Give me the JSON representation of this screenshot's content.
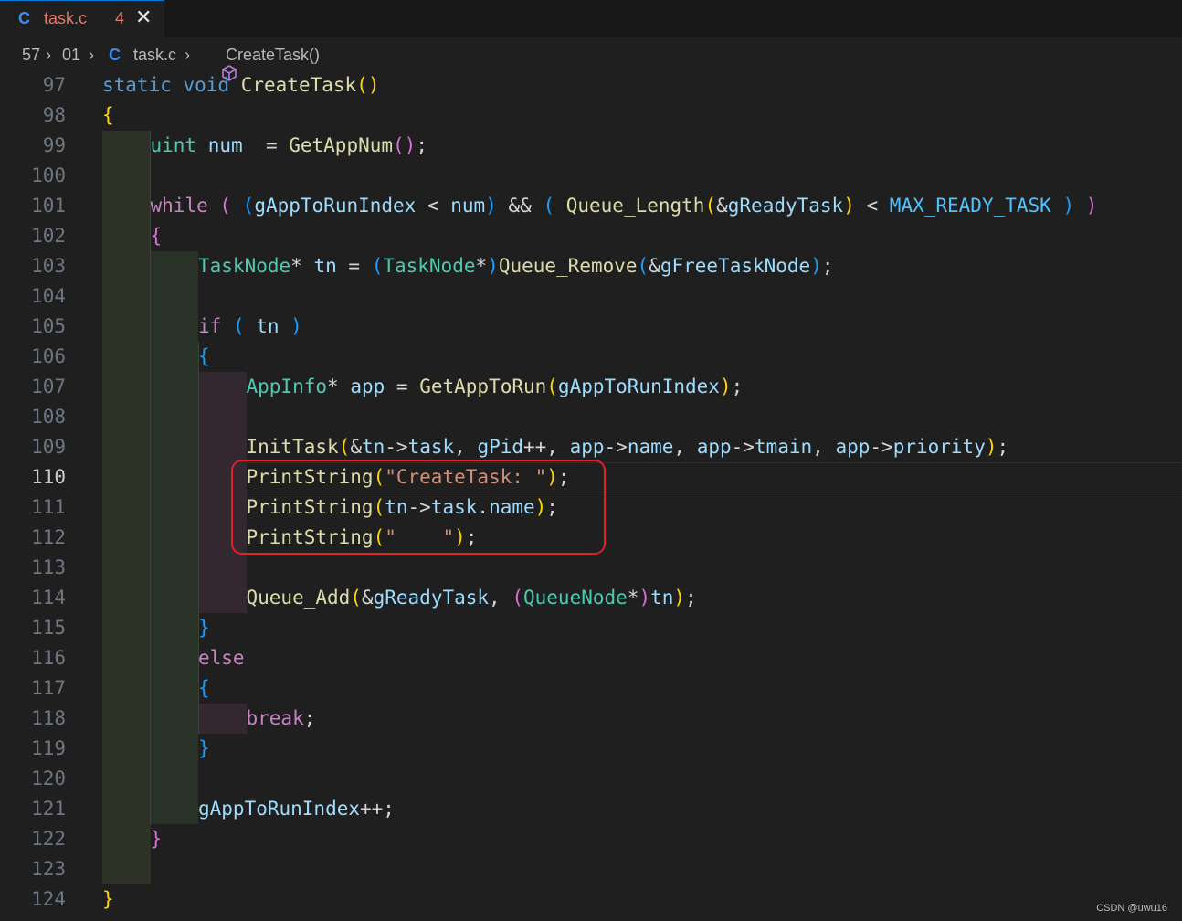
{
  "tab": {
    "language_icon": "C",
    "file_name": "task.c",
    "problem_count": "4",
    "close_icon": "close-icon"
  },
  "breadcrumb": {
    "segments": [
      "57",
      "01",
      "task.c",
      "CreateTask()"
    ],
    "language_icon": "C",
    "symbol_icon": "method-cube-icon"
  },
  "editor": {
    "active_line": 110,
    "lines": [
      {
        "n": "97",
        "indent": 0,
        "tokens": [
          [
            "k",
            "static "
          ],
          [
            "k",
            "void "
          ],
          [
            "f",
            "CreateTask"
          ],
          [
            "p1",
            "()"
          ]
        ]
      },
      {
        "n": "98",
        "indent": 0,
        "tokens": [
          [
            "p1",
            "{"
          ]
        ]
      },
      {
        "n": "99",
        "indent": 1,
        "tokens": [
          [
            "t",
            "uint "
          ],
          [
            "v",
            "num"
          ],
          [
            "",
            "  = "
          ],
          [
            "f",
            "GetAppNum"
          ],
          [
            "p2",
            "()"
          ],
          [
            "",
            ";"
          ]
        ]
      },
      {
        "n": "100",
        "indent": 1,
        "tokens": []
      },
      {
        "n": "101",
        "indent": 1,
        "tokens": [
          [
            "c",
            "while "
          ],
          [
            "p2",
            "( "
          ],
          [
            "p3",
            "("
          ],
          [
            "v",
            "gAppToRunIndex"
          ],
          [
            "",
            " < "
          ],
          [
            "v",
            "num"
          ],
          [
            "p3",
            ")"
          ],
          [
            "",
            " && "
          ],
          [
            "p3",
            "( "
          ],
          [
            "f",
            "Queue_Length"
          ],
          [
            "p1",
            "("
          ],
          [
            "",
            "&"
          ],
          [
            "v",
            "gReadyTask"
          ],
          [
            "p1",
            ")"
          ],
          [
            "",
            " < "
          ],
          [
            "m",
            "MAX_READY_TASK"
          ],
          [
            "p3",
            " )"
          ],
          [
            "p2",
            " )"
          ]
        ]
      },
      {
        "n": "102",
        "indent": 1,
        "tokens": [
          [
            "p2",
            "{"
          ]
        ]
      },
      {
        "n": "103",
        "indent": 2,
        "tokens": [
          [
            "t",
            "TaskNode"
          ],
          [
            "",
            "* "
          ],
          [
            "v",
            "tn"
          ],
          [
            "",
            " = "
          ],
          [
            "p3",
            "("
          ],
          [
            "t",
            "TaskNode"
          ],
          [
            "",
            "*"
          ],
          [
            "p3",
            ")"
          ],
          [
            "f",
            "Queue_Remove"
          ],
          [
            "p3",
            "("
          ],
          [
            "",
            "&"
          ],
          [
            "v",
            "gFreeTaskNode"
          ],
          [
            "p3",
            ")"
          ],
          [
            "",
            ";"
          ]
        ]
      },
      {
        "n": "104",
        "indent": 2,
        "tokens": []
      },
      {
        "n": "105",
        "indent": 2,
        "tokens": [
          [
            "c",
            "if "
          ],
          [
            "p3",
            "( "
          ],
          [
            "v",
            "tn"
          ],
          [
            "p3",
            " )"
          ]
        ]
      },
      {
        "n": "106",
        "indent": 2,
        "tokens": [
          [
            "p3",
            "{"
          ]
        ]
      },
      {
        "n": "107",
        "indent": 3,
        "tokens": [
          [
            "t",
            "AppInfo"
          ],
          [
            "",
            "* "
          ],
          [
            "v",
            "app"
          ],
          [
            "",
            " = "
          ],
          [
            "f",
            "GetAppToRun"
          ],
          [
            "p1",
            "("
          ],
          [
            "v",
            "gAppToRunIndex"
          ],
          [
            "p1",
            ")"
          ],
          [
            "",
            ";"
          ]
        ]
      },
      {
        "n": "108",
        "indent": 3,
        "tokens": []
      },
      {
        "n": "109",
        "indent": 3,
        "tokens": [
          [
            "f",
            "InitTask"
          ],
          [
            "p1",
            "("
          ],
          [
            "",
            "&"
          ],
          [
            "v",
            "tn"
          ],
          [
            "",
            "->"
          ],
          [
            "v",
            "task"
          ],
          [
            "",
            ", "
          ],
          [
            "v",
            "gPid"
          ],
          [
            "",
            "++, "
          ],
          [
            "v",
            "app"
          ],
          [
            "",
            "->"
          ],
          [
            "v",
            "name"
          ],
          [
            "",
            ", "
          ],
          [
            "v",
            "app"
          ],
          [
            "",
            "->"
          ],
          [
            "v",
            "tmain"
          ],
          [
            "",
            ", "
          ],
          [
            "v",
            "app"
          ],
          [
            "",
            "->"
          ],
          [
            "v",
            "priority"
          ],
          [
            "p1",
            ")"
          ],
          [
            "",
            ";"
          ]
        ]
      },
      {
        "n": "110",
        "indent": 3,
        "tokens": [
          [
            "f",
            "PrintString"
          ],
          [
            "p1",
            "("
          ],
          [
            "s",
            "\"CreateTask: \""
          ],
          [
            "p1",
            ")"
          ],
          [
            "",
            ";"
          ]
        ]
      },
      {
        "n": "111",
        "indent": 3,
        "tokens": [
          [
            "f",
            "PrintString"
          ],
          [
            "p1",
            "("
          ],
          [
            "v",
            "tn"
          ],
          [
            "",
            "->"
          ],
          [
            "v",
            "task"
          ],
          [
            "",
            "."
          ],
          [
            "v",
            "name"
          ],
          [
            "p1",
            ")"
          ],
          [
            "",
            ";"
          ]
        ]
      },
      {
        "n": "112",
        "indent": 3,
        "tokens": [
          [
            "f",
            "PrintString"
          ],
          [
            "p1",
            "("
          ],
          [
            "s",
            "\"    \""
          ],
          [
            "p1",
            ")"
          ],
          [
            "",
            ";"
          ]
        ]
      },
      {
        "n": "113",
        "indent": 3,
        "tokens": []
      },
      {
        "n": "114",
        "indent": 3,
        "tokens": [
          [
            "f",
            "Queue_Add"
          ],
          [
            "p1",
            "("
          ],
          [
            "",
            "&"
          ],
          [
            "v",
            "gReadyTask"
          ],
          [
            "",
            ", "
          ],
          [
            "p2",
            "("
          ],
          [
            "t",
            "QueueNode"
          ],
          [
            "",
            "*"
          ],
          [
            "p2",
            ")"
          ],
          [
            "v",
            "tn"
          ],
          [
            "p1",
            ")"
          ],
          [
            "",
            ";"
          ]
        ]
      },
      {
        "n": "115",
        "indent": 2,
        "tokens": [
          [
            "p3",
            "}"
          ]
        ]
      },
      {
        "n": "116",
        "indent": 2,
        "tokens": [
          [
            "c",
            "else"
          ]
        ]
      },
      {
        "n": "117",
        "indent": 2,
        "tokens": [
          [
            "p3",
            "{"
          ]
        ]
      },
      {
        "n": "118",
        "indent": 3,
        "tokens": [
          [
            "c",
            "break"
          ],
          [
            "",
            ";"
          ]
        ]
      },
      {
        "n": "119",
        "indent": 2,
        "tokens": [
          [
            "p3",
            "}"
          ]
        ]
      },
      {
        "n": "120",
        "indent": 2,
        "tokens": []
      },
      {
        "n": "121",
        "indent": 2,
        "tokens": [
          [
            "v",
            "gAppToRunIndex"
          ],
          [
            "",
            "++;"
          ]
        ]
      },
      {
        "n": "122",
        "indent": 1,
        "tokens": [
          [
            "p2",
            "}"
          ]
        ]
      },
      {
        "n": "123",
        "indent": 1,
        "tokens": []
      },
      {
        "n": "124",
        "indent": 0,
        "tokens": [
          [
            "p1",
            "}"
          ]
        ]
      }
    ]
  },
  "colors": {
    "indent_level_1": "#2e3126",
    "indent_level_2": "#283227",
    "indent_level_3": "#33282f",
    "highlight_box": "#e0202a"
  },
  "watermark": "CSDN @uwu16"
}
